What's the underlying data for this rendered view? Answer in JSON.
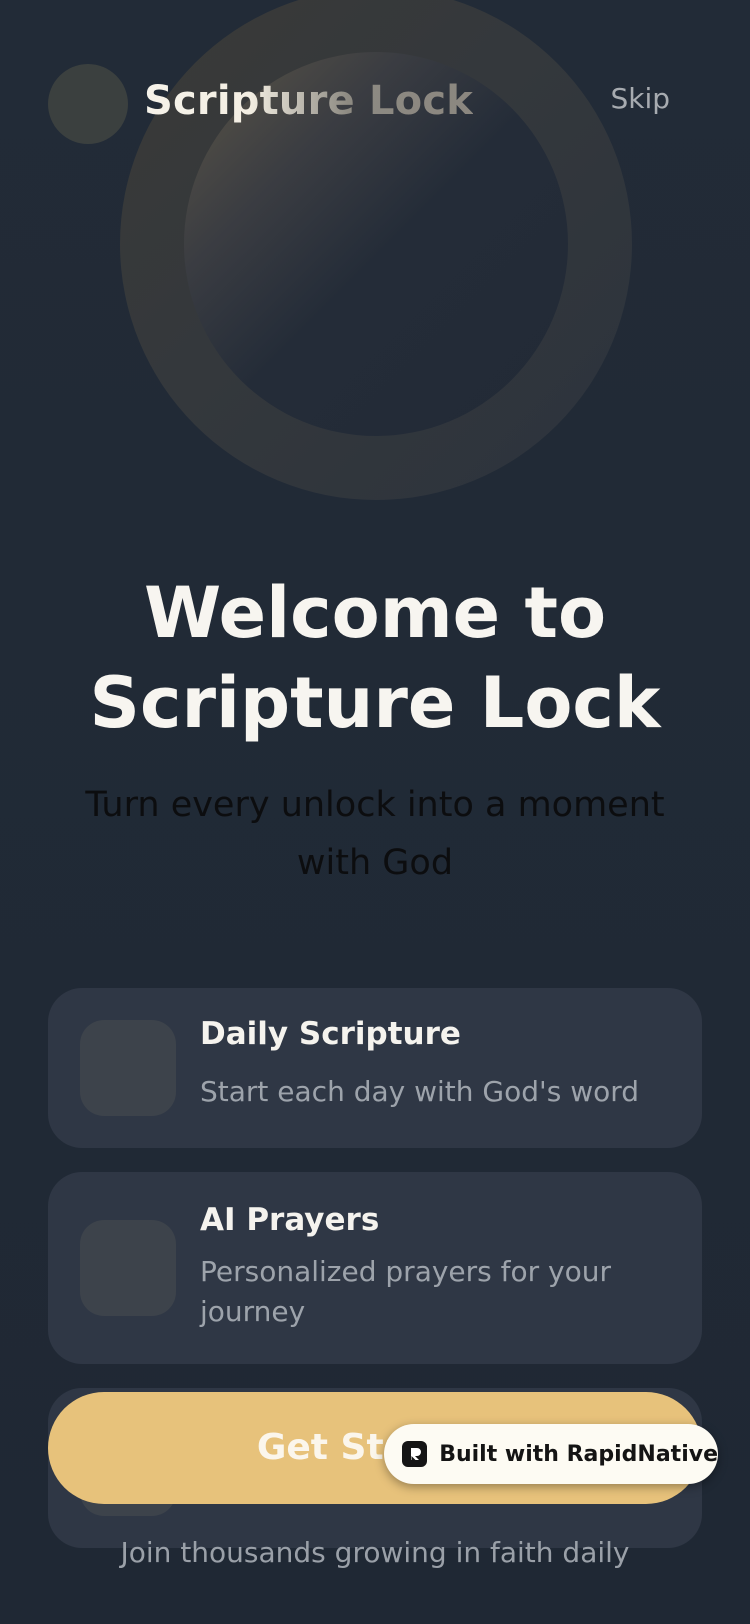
{
  "header": {
    "app_name": "Scripture Lock",
    "skip_label": "Skip",
    "logo_icon": "app-logo-circle"
  },
  "hero": {
    "title_line1": "Welcome to",
    "title_line2": "Scripture Lock",
    "subtitle": "Turn every unlock into a moment with God",
    "decoration": "ring-orb"
  },
  "features": [
    {
      "title": "Daily Scripture",
      "description": "Start each day with God's word",
      "icon": "scripture-icon"
    },
    {
      "title": "AI Prayers",
      "description": "Personalized prayers for your journey",
      "icon": "prayer-icon"
    },
    {
      "title": "",
      "description": "",
      "icon": "feature-icon"
    }
  ],
  "cta": {
    "label": "Get Started"
  },
  "footer": {
    "note": "Join thousands growing in faith daily"
  },
  "badge": {
    "label": "Built with RapidNative",
    "icon": "rapidnative-logo"
  },
  "colors": {
    "background": "#202936",
    "card": "#2f3745",
    "accent": "#e7c27b",
    "title_text": "#f7f5f0",
    "muted_text": "#9da3ab"
  }
}
